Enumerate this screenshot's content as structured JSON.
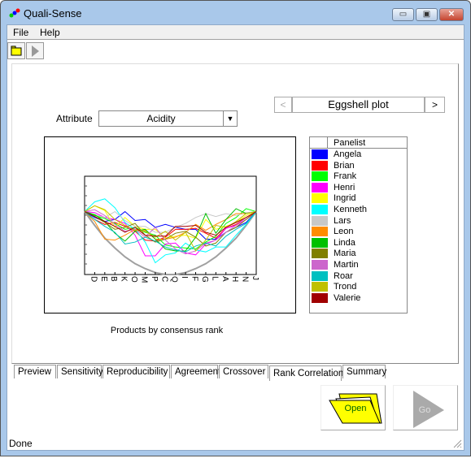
{
  "window": {
    "title": "Quali-Sense",
    "minimize": "▭",
    "maximize": "▣",
    "close": "✕"
  },
  "menu": [
    "File",
    "Help"
  ],
  "toolbar": {
    "open_icon": "folder-icon",
    "go_icon": "play-icon"
  },
  "view_nav": {
    "prev": "<",
    "title": "Eggshell plot",
    "next": ">"
  },
  "attribute": {
    "label": "Attribute",
    "value": "Acidity"
  },
  "x_caption": "Products by consensus rank",
  "legend": {
    "header": "Panelist"
  },
  "tabs": [
    "Preview",
    "Sensitivity",
    "Reproducibility",
    "Agreement",
    "Crossover",
    "Rank Correlation",
    "Summary"
  ],
  "active_tab": "Rank Correlation",
  "buttons": {
    "open": "Open",
    "go": "Go"
  },
  "status": "Done",
  "chart_data": {
    "type": "line",
    "title": "Eggshell plot",
    "xlabel": "Products by consensus rank",
    "categories": [
      "D",
      "E",
      "B",
      "K",
      "O",
      "M",
      "P",
      "C",
      "Q",
      "I",
      "F",
      "G",
      "L",
      "A",
      "H",
      "N",
      "J"
    ],
    "grid": false,
    "legend": "right",
    "reference_curve": {
      "color": "#a0a0a0",
      "values": [
        6.4,
        5.0,
        3.7,
        2.7,
        1.8,
        1.1,
        0.6,
        0.2,
        0.0,
        0.0,
        0.2,
        0.6,
        1.1,
        1.8,
        2.7,
        3.7,
        5.0,
        6.4
      ]
    },
    "series": [
      {
        "name": "Angela",
        "color": "#0000FF",
        "values": [
          6.4,
          5.8,
          5.4,
          5.6,
          6.4,
          5.5,
          5.6,
          4.8,
          5.1,
          4.8,
          4.6,
          4.6,
          3.6,
          3.6,
          4.3,
          4.8,
          5.3,
          6.4
        ]
      },
      {
        "name": "Brian",
        "color": "#FF0000",
        "values": [
          6.4,
          5.6,
          5.1,
          5.3,
          4.9,
          4.4,
          3.5,
          3.4,
          3.8,
          4.6,
          4.6,
          4.7,
          4.2,
          3.7,
          4.7,
          5.1,
          5.8,
          6.4
        ]
      },
      {
        "name": "Frank",
        "color": "#00FF00",
        "values": [
          6.4,
          6.0,
          5.7,
          5.2,
          4.6,
          4.8,
          4.3,
          4.0,
          3.0,
          2.8,
          2.7,
          2.6,
          3.3,
          3.9,
          5.2,
          5.8,
          6.7,
          6.4
        ]
      },
      {
        "name": "Henri",
        "color": "#FF00FF",
        "values": [
          6.4,
          6.3,
          5.8,
          5.6,
          5.2,
          4.0,
          1.9,
          1.9,
          3.1,
          3.2,
          2.2,
          2.0,
          3.1,
          3.5,
          4.7,
          5.0,
          5.6,
          6.4
        ]
      },
      {
        "name": "Ingrid",
        "color": "#FFFF00",
        "values": [
          6.4,
          7.0,
          6.5,
          4.8,
          5.8,
          4.9,
          4.6,
          4.6,
          3.7,
          3.9,
          4.0,
          3.7,
          5.6,
          4.6,
          4.9,
          5.3,
          6.0,
          6.4
        ]
      },
      {
        "name": "Kenneth",
        "color": "#00FFFF",
        "values": [
          6.4,
          7.4,
          7.7,
          6.8,
          5.3,
          4.6,
          3.3,
          1.2,
          2.0,
          2.2,
          3.2,
          2.5,
          2.3,
          2.8,
          2.8,
          4.0,
          5.1,
          6.4
        ]
      },
      {
        "name": "Lars",
        "color": "#C8C8C8",
        "values": [
          6.4,
          6.1,
          5.8,
          6.4,
          5.5,
          4.9,
          4.9,
          4.3,
          4.3,
          4.8,
          5.2,
          5.8,
          6.2,
          5.9,
          6.2,
          6.0,
          6.3,
          6.4
        ]
      },
      {
        "name": "Leon",
        "color": "#FF8C00",
        "values": [
          6.4,
          5.4,
          3.6,
          3.5,
          4.0,
          4.6,
          4.5,
          3.6,
          3.6,
          3.8,
          4.3,
          5.1,
          4.5,
          5.1,
          5.6,
          6.2,
          6.2,
          6.4
        ]
      },
      {
        "name": "Linda",
        "color": "#00C000",
        "values": [
          6.4,
          6.1,
          5.4,
          4.2,
          3.4,
          4.4,
          4.6,
          3.6,
          2.6,
          2.4,
          2.4,
          3.8,
          6.2,
          4.2,
          5.6,
          6.7,
          6.2,
          6.4
        ]
      },
      {
        "name": "Maria",
        "color": "#808000",
        "values": [
          6.4,
          5.9,
          5.3,
          4.6,
          4.8,
          5.2,
          4.0,
          3.3,
          3.6,
          4.2,
          4.4,
          3.8,
          2.9,
          3.2,
          4.3,
          4.8,
          5.6,
          6.4
        ]
      },
      {
        "name": "Martin",
        "color": "#CC66CC",
        "values": [
          6.4,
          6.6,
          6.0,
          5.1,
          4.4,
          4.6,
          3.8,
          4.8,
          3.5,
          2.6,
          2.1,
          2.4,
          3.2,
          3.5,
          4.3,
          5.0,
          5.8,
          6.4
        ]
      },
      {
        "name": "Roar",
        "color": "#00C0C0",
        "values": [
          6.4,
          5.6,
          4.9,
          4.3,
          3.1,
          3.3,
          3.8,
          3.4,
          2.8,
          2.5,
          2.3,
          2.9,
          3.2,
          2.9,
          3.9,
          4.6,
          5.2,
          6.4
        ]
      },
      {
        "name": "Trond",
        "color": "#C0C000",
        "values": [
          6.4,
          7.0,
          6.6,
          5.6,
          5.0,
          4.5,
          4.4,
          3.8,
          4.4,
          3.5,
          4.3,
          2.4,
          3.5,
          5.0,
          4.8,
          5.4,
          6.2,
          6.4
        ]
      },
      {
        "name": "Valerie",
        "color": "#A00000",
        "values": [
          6.4,
          5.9,
          5.4,
          4.9,
          4.3,
          4.8,
          4.0,
          3.9,
          3.9,
          4.9,
          4.9,
          5.0,
          4.3,
          4.0,
          4.8,
          5.3,
          5.8,
          6.4
        ]
      }
    ]
  }
}
